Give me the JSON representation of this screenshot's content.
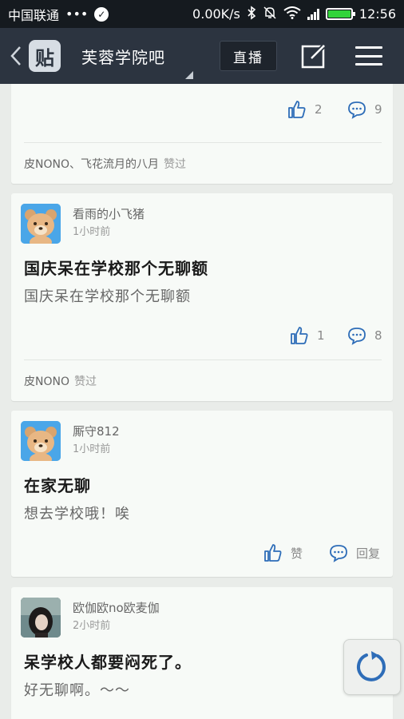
{
  "status_bar": {
    "carrier": "中国联通",
    "dots": "•••",
    "net_speed": "0.00K/s",
    "time": "12:56"
  },
  "nav": {
    "forum_name": "芙蓉学院吧",
    "logo_text": "贴",
    "live_label": "直播"
  },
  "posts": [
    {
      "like_count": "2",
      "reply_count": "9",
      "liked_by": "皮NONO、飞花流月的八月",
      "liked_suffix": "赞过"
    },
    {
      "author": "看雨的小飞猪",
      "time": "1小时前",
      "title": "国庆呆在学校那个无聊额",
      "body": "国庆呆在学校那个无聊额",
      "like_count": "1",
      "reply_count": "8",
      "liked_by": "皮NONO",
      "liked_suffix": "赞过"
    },
    {
      "author": "厮守812",
      "time": "1小时前",
      "title": "在家无聊",
      "body": "想去学校哦！唉",
      "like_label": "赞",
      "reply_label": "回复"
    },
    {
      "author": "欧伽欧no欧麦伽",
      "time": "2小时前",
      "title": "呆学校人都要闷死了。",
      "body": "好无聊啊。～～"
    }
  ],
  "icons": {
    "check": "check-circle-icon",
    "bluetooth": "bluetooth-icon",
    "mute": "bell-off-icon",
    "wifi": "wifi-icon",
    "signal": "signal-icon",
    "battery": "battery-icon",
    "back": "chevron-left-icon",
    "edit": "edit-icon",
    "menu": "menu-icon",
    "like": "thumbs-up-icon",
    "reply": "comment-icon",
    "refresh": "refresh-icon"
  },
  "colors": {
    "status_bg": "#151a1f",
    "nav_bg": "#2c3440",
    "accent_blue": "#2e6db8",
    "battery": "#32d33a"
  }
}
